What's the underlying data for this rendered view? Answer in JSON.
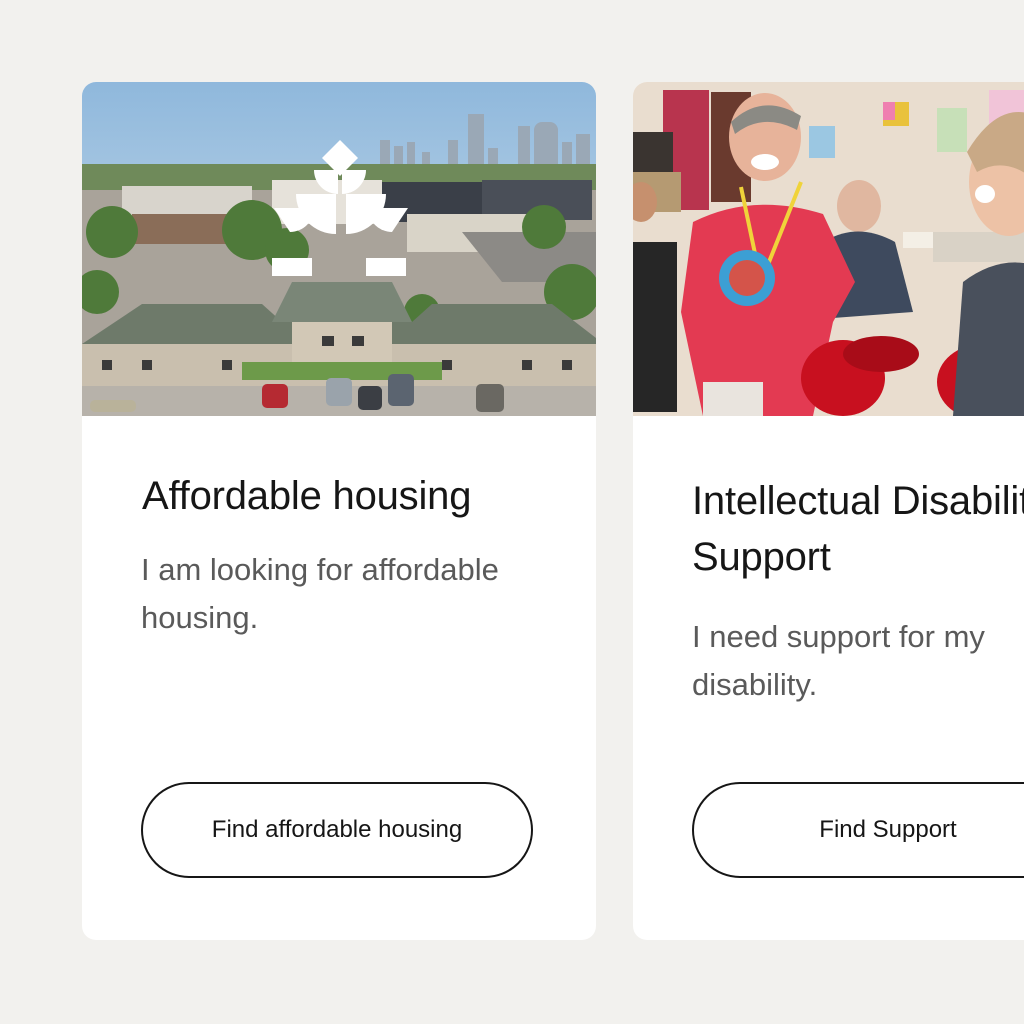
{
  "cards": [
    {
      "title": "Affordable housing",
      "description": "I am looking for affordable housing.",
      "button_label": "Find affordable housing",
      "image": "aerial-photo-of-apartment-complex-with-city-skyline-and-logo"
    },
    {
      "title": "Intellectual Disability Support",
      "description": "I need support for my disability.",
      "button_label": "Find Support",
      "image": "photo-of-smiling-people-with-boxing-gloves"
    }
  ],
  "colors": {
    "page_background": "#f2f1ee",
    "card_background": "#ffffff",
    "title_text": "#161616",
    "body_text": "#5a5a5a",
    "button_border": "#161616"
  }
}
